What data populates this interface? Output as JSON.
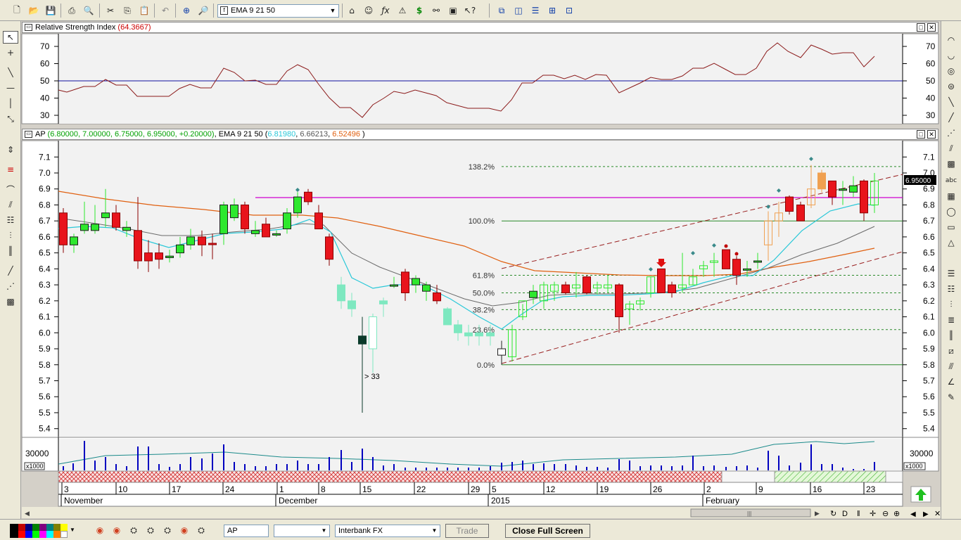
{
  "toolbar": {
    "indicator_select": "EMA 9 21 50",
    "icons": [
      "new-icon",
      "open-icon",
      "save-icon",
      "print-icon",
      "print-preview-icon",
      "cut-icon",
      "copy-icon",
      "paste-icon",
      "undo-icon",
      "crosshair-icon",
      "zoom-icon",
      "attach-icon",
      "analyst-icon",
      "formula-icon",
      "alert-icon",
      "dollar-icon",
      "binoculars-icon",
      "properties-icon",
      "help-icon",
      "cascade-icon",
      "tile-vertical-icon",
      "tile-horizontal-icon",
      "tile-grid-icon",
      "arrange-icon"
    ]
  },
  "rsi_pane": {
    "title": "Relative Strength Index",
    "value": "(64.3667)",
    "levels": [
      "70",
      "60",
      "50",
      "40",
      "30"
    ],
    "value_color": "#cc0000"
  },
  "price_pane": {
    "symbol": "AP",
    "ohlc": "(6.80000, 7.00000, 6.75000, 6.95000, +0.20000)",
    "indicator_label": "EMA 9 21 50",
    "ema_open": "(",
    "ema9": "6.81980",
    "ema21": "6.66213",
    "ema50": "6.52496",
    "ema_close": ")",
    "last_price_tag": "6.95000",
    "annotation": "> 33",
    "price_labels": [
      "7.1",
      "7.0",
      "6.9",
      "6.8",
      "6.7",
      "6.6",
      "6.5",
      "6.4",
      "6.3",
      "6.2",
      "6.1",
      "6.0",
      "5.9",
      "5.8",
      "5.7",
      "5.6",
      "5.5",
      "5.4"
    ],
    "fib_levels": [
      {
        "label": "138.2%",
        "price": 7.04
      },
      {
        "label": "100.0%",
        "price": 6.7
      },
      {
        "label": "61.8%",
        "price": 6.36
      },
      {
        "label": "50.0%",
        "price": 6.25
      },
      {
        "label": "38.2%",
        "price": 6.145
      },
      {
        "label": "23.6%",
        "price": 6.02
      },
      {
        "label": "0.0%",
        "price": 5.8
      }
    ],
    "colors": {
      "bull": "#2ee82e",
      "bull_pale": "#7ee8c0",
      "bear": "#e8141c",
      "ema9": "#2ac8d8",
      "ema21": "#6a6a6a",
      "ema50": "#e06010",
      "magenta": "#d000d0",
      "channel": "#9a2020"
    }
  },
  "volume_pane": {
    "scale_label": "30000",
    "multiplier": "x1000",
    "volume_color": "#0000c0"
  },
  "time_axis": {
    "day_labels": [
      "3",
      "10",
      "17",
      "24",
      "1",
      "8",
      "15",
      "22",
      "29",
      "5",
      "12",
      "19",
      "26",
      "2",
      "9",
      "16",
      "23"
    ],
    "month_labels": [
      "November",
      "December",
      "2015",
      "February"
    ]
  },
  "bottom_bar": {
    "symbol_input": "AP",
    "data_source": "Interbank FX",
    "trade_button": "Trade",
    "close_full_screen": "Close Full Screen"
  }
}
